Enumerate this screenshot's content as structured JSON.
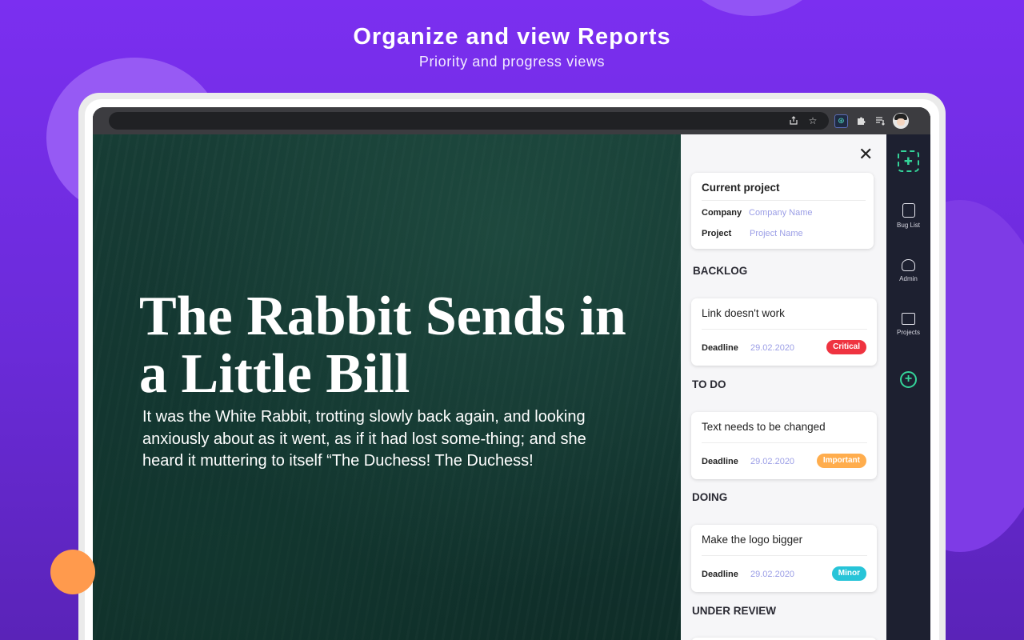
{
  "hero": {
    "title": "Organize and view Reports",
    "subtitle": "Priority and progress views"
  },
  "browser": {
    "toolbar_icons": [
      "share-icon",
      "star-icon",
      "extension-bugtracker-icon",
      "puzzle-icon",
      "reading-list-icon",
      "profile-avatar"
    ]
  },
  "article": {
    "title": "The Rabbit Sends in a Little Bill",
    "body": "It was the White Rabbit, trotting slowly back again, and looking anxiously about as it went, as if it had lost some-thing; and she heard it muttering to itself “The Duchess! The Duchess!"
  },
  "panel": {
    "close_symbol": "✕",
    "project": {
      "heading": "Current project",
      "company_label": "Company",
      "company_value": "Company Name",
      "project_label": "Project",
      "project_value": "Project Name"
    },
    "sections": [
      {
        "heading": "BACKLOG",
        "task": {
          "title": "Link doesn't work",
          "deadline_label": "Deadline",
          "deadline": "29.02.2020",
          "priority": "Critical",
          "priority_color": "#ef3340"
        }
      },
      {
        "heading": "TO DO",
        "task": {
          "title": "Text needs to be changed",
          "deadline_label": "Deadline",
          "deadline": "29.02.2020",
          "priority": "Important",
          "priority_color": "#ffad4d"
        }
      },
      {
        "heading": "DOING",
        "task": {
          "title": "Make the logo bigger",
          "deadline_label": "Deadline",
          "deadline": "29.02.2020",
          "priority": "Minor",
          "priority_color": "#27c4d8"
        }
      },
      {
        "heading": "UNDER REVIEW"
      }
    ]
  },
  "sidebar": {
    "logo_icon": "bug-tracker-logo-icon",
    "items": [
      {
        "label": "Bug List",
        "icon": "clipboard-icon"
      },
      {
        "label": "Admin",
        "icon": "gauge-icon"
      },
      {
        "label": "Projects",
        "icon": "puzzle-icon"
      }
    ],
    "add_icon": "plus-circle-icon",
    "accent_color": "#34d399"
  },
  "colors": {
    "background": "#7b2ff0",
    "accent_orange": "#ff9a4d",
    "sidebar_bg": "#1d2030"
  }
}
